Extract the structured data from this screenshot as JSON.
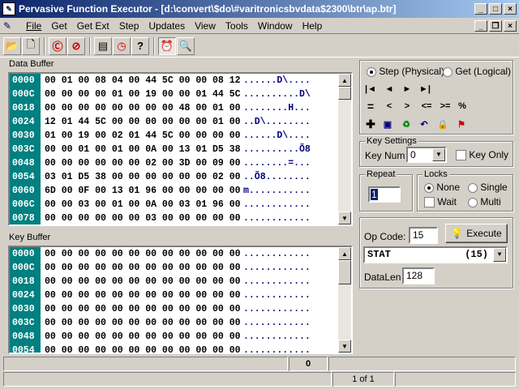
{
  "window": {
    "title": "Pervasive Function Executor - [d:\\convert\\$do\\#varitronicsbvdata$2300\\btr\\ap.btr]"
  },
  "caption_buttons": {
    "minimize": "_",
    "maximize": "□",
    "close": "×"
  },
  "mdi_buttons": {
    "minimize": "_",
    "restore": "❐",
    "close": "×"
  },
  "menu": [
    "File",
    "Get",
    "Get Ext",
    "Step",
    "Updates",
    "View",
    "Tools",
    "Window",
    "Help"
  ],
  "toolbar": {
    "icons": [
      "open-folder-icon",
      "new-file-icon",
      "reset-icon",
      "stop-icon",
      "properties-icon",
      "clock-icon",
      "help-icon",
      "alarm-clock-icon",
      "magnifier-icon"
    ]
  },
  "data_buffer": {
    "label": "Data Buffer",
    "rows": [
      {
        "offset": "0000",
        "hex": "00 01 00 08 04 00 44 5C 00 00 08 12",
        "ascii": "......D\\...."
      },
      {
        "offset": "000C",
        "hex": "00 00 00 00 01 00 19 00 00 01 44 5C",
        "ascii": "..........D\\"
      },
      {
        "offset": "0018",
        "hex": "00 00 00 00 00 00 00 00 48 00 01 00",
        "ascii": "........H..."
      },
      {
        "offset": "0024",
        "hex": "12 01 44 5C 00 00 00 00 00 00 01 00",
        "ascii": "..D\\........"
      },
      {
        "offset": "0030",
        "hex": "01 00 19 00 02 01 44 5C 00 00 00 00",
        "ascii": "......D\\...."
      },
      {
        "offset": "003C",
        "hex": "00 00 01 00 01 00 0A 00 13 01 D5 38",
        "ascii": "..........Õ8"
      },
      {
        "offset": "0048",
        "hex": "00 00 00 00 00 00 02 00 3D 00 09 00",
        "ascii": "........=..."
      },
      {
        "offset": "0054",
        "hex": "03 01 D5 38 00 00 00 00 00 00 02 00",
        "ascii": "..Õ8........"
      },
      {
        "offset": "0060",
        "hex": "6D 00 0F 00 13 01 96 00 00 00 00 00",
        "ascii": "m..........."
      },
      {
        "offset": "006C",
        "hex": "00 00 03 00 01 00 0A 00 03 01 96 00",
        "ascii": "............"
      },
      {
        "offset": "0078",
        "hex": "00 00 00 00 00 00 03 00 00 00 00 00",
        "ascii": "............"
      }
    ]
  },
  "key_buffer": {
    "label": "Key Buffer",
    "rows": [
      {
        "offset": "0000",
        "hex": "00 00 00 00 00 00 00 00 00 00 00 00",
        "ascii": "............"
      },
      {
        "offset": "000C",
        "hex": "00 00 00 00 00 00 00 00 00 00 00 00",
        "ascii": "............"
      },
      {
        "offset": "0018",
        "hex": "00 00 00 00 00 00 00 00 00 00 00 00",
        "ascii": "............"
      },
      {
        "offset": "0024",
        "hex": "00 00 00 00 00 00 00 00 00 00 00 00",
        "ascii": "............"
      },
      {
        "offset": "0030",
        "hex": "00 00 00 00 00 00 00 00 00 00 00 00",
        "ascii": "............"
      },
      {
        "offset": "003C",
        "hex": "00 00 00 00 00 00 00 00 00 00 00 00",
        "ascii": "............"
      },
      {
        "offset": "0048",
        "hex": "00 00 00 00 00 00 00 00 00 00 00 00",
        "ascii": "............"
      },
      {
        "offset": "0054",
        "hex": "00 00 00 00 00 00 00 00 00 00 00 00",
        "ascii": "............"
      }
    ]
  },
  "mode": {
    "step_label": "Step (Physical)",
    "get_label": "Get (Logical)",
    "selected": "step"
  },
  "nav": {
    "first": "|◄",
    "prev": "◄",
    "next": "►",
    "last": "►|",
    "eq": "=",
    "lt": "<",
    "gt": ">",
    "le": "<=",
    "ge": ">=",
    "pct": "%"
  },
  "action_icons": [
    "insert-plus-icon",
    "save-disk-icon",
    "recycle-delete-icon",
    "undo-icon",
    "lock-icon",
    "flag-icon"
  ],
  "key_settings": {
    "title": "Key Settings",
    "key_num_label": "Key Num",
    "key_num_value": "0",
    "key_only_label": "Key Only"
  },
  "repeat": {
    "title": "Repeat",
    "value": "1"
  },
  "locks": {
    "title": "Locks",
    "none": "None",
    "single": "Single",
    "wait": "Wait",
    "multi": "Multi",
    "selected": "none"
  },
  "op": {
    "label": "Op Code:",
    "value": "15",
    "execute": "Execute",
    "function": "STAT",
    "function_code": "(15)",
    "datalen_label": "DataLen",
    "datalen_value": "128"
  },
  "status": {
    "cell1": "0",
    "page": "1 of 1"
  }
}
